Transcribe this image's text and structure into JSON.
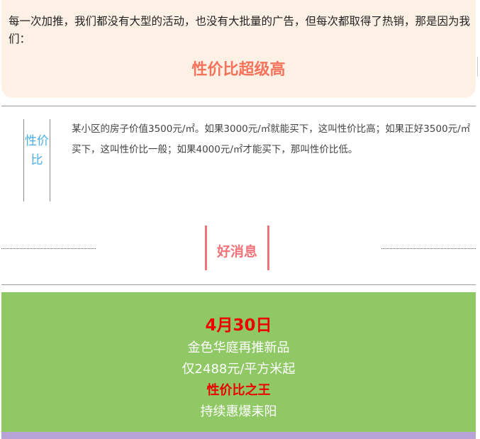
{
  "intro": {
    "text": "每一次加推，我们都没有大型的活动，也没有大批量的广告，但每次都取得了热销，那是因为我们：",
    "highlight": "性价比超级高"
  },
  "definition": {
    "term": "性价比",
    "body": "某小区的房子价值3500元/㎡。如果3000元/㎡就能买下，这叫性价比高；如果正好3500元/㎡买下，这叫性价比一般；如果4000元/㎡才能买下，那叫性价比低。"
  },
  "news": {
    "title": "好消息"
  },
  "promo": {
    "date": "4月30日",
    "line1": "金色华庭再推新品",
    "line2": "仅2488元/平方米起",
    "line3": "性价比之王",
    "line4": "持续惠爆耒阳"
  },
  "colors": {
    "accent_orange": "#f4735a",
    "accent_pink": "#f0737a",
    "term_blue": "#4aaee8",
    "promo_green": "#8fc864",
    "promo_red": "#ee0000"
  }
}
